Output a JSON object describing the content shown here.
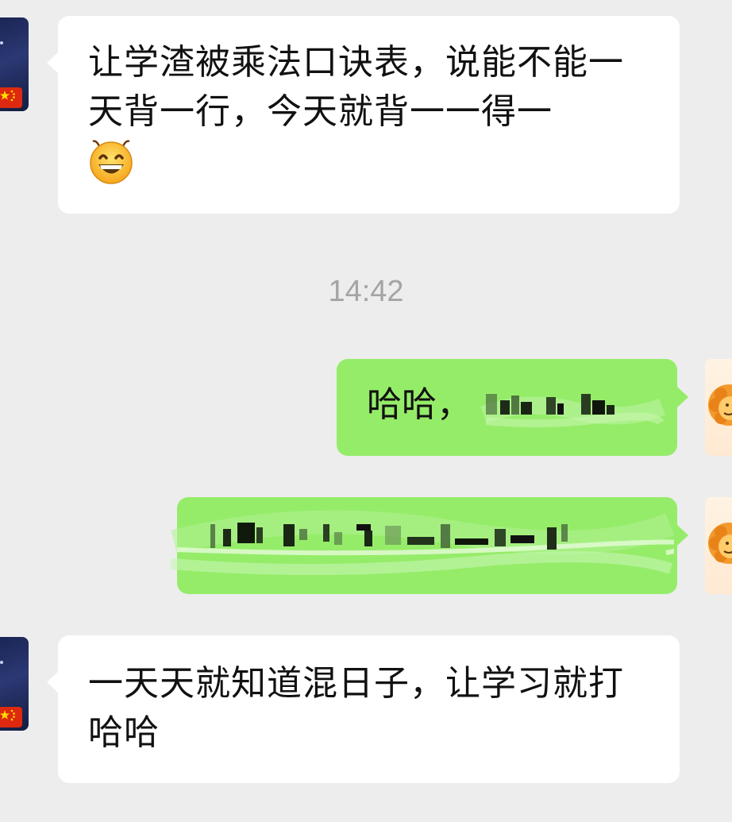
{
  "messages": [
    {
      "side": "left",
      "text": "让学渣被乘法口诀表，说能不能一天背一行，今天就背一一得一",
      "emoji": "grinning-face-emoji"
    },
    {
      "side": "timestamp",
      "text": "14:42"
    },
    {
      "side": "right",
      "text": "哈哈，"
    },
    {
      "side": "right",
      "text": ""
    },
    {
      "side": "left",
      "text": "一天天就知道混日子，让学习就打哈哈"
    }
  ],
  "colors": {
    "background": "#ededed",
    "incoming_bubble": "#ffffff",
    "outgoing_bubble": "#95ec69",
    "timestamp": "#a4a4a4",
    "text": "#111111"
  }
}
